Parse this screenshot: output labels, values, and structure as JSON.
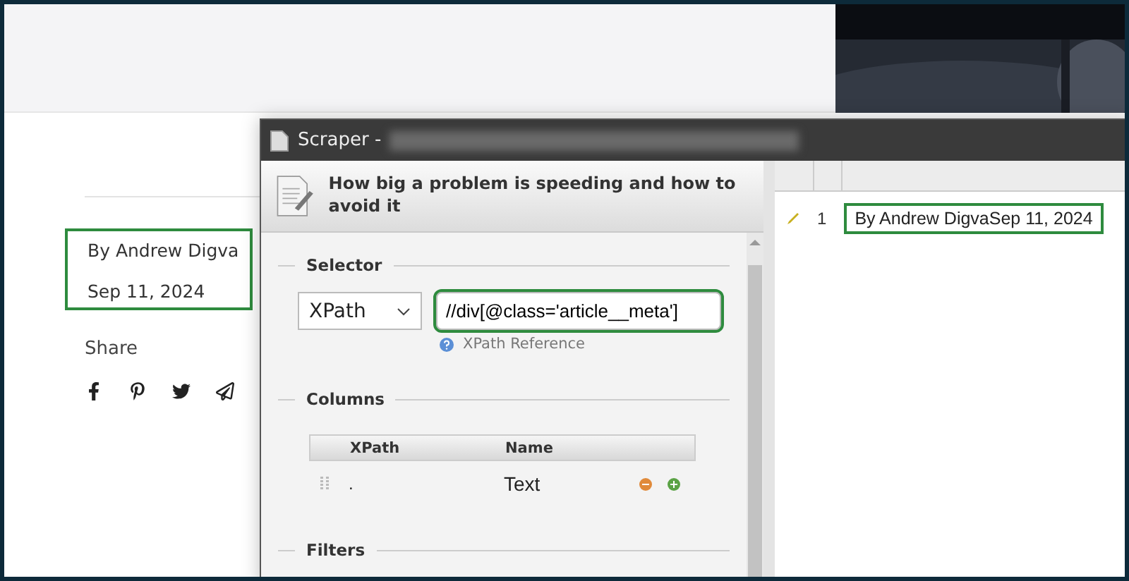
{
  "page": {
    "meta": {
      "author": "By Andrew Digva",
      "date": "Sep 11, 2024",
      "highlighted": true
    },
    "share_label": "Share"
  },
  "scraper": {
    "title": "Scraper -",
    "heading": "How big a problem is speeding and how to avoid it",
    "selector": {
      "legend": "Selector",
      "type": "XPath",
      "value": "//div[@class='article__meta']",
      "highlighted": true,
      "reference_link": "XPath Reference"
    },
    "columns": {
      "legend": "Columns",
      "headers": [
        "XPath",
        "Name"
      ],
      "rows": [
        {
          "xpath": ".",
          "name": "Text"
        }
      ]
    },
    "filters": {
      "legend": "Filters"
    },
    "results": {
      "rows": [
        {
          "index": "1",
          "text": "By Andrew DigvaSep 11, 2024",
          "highlighted": true
        }
      ]
    }
  }
}
